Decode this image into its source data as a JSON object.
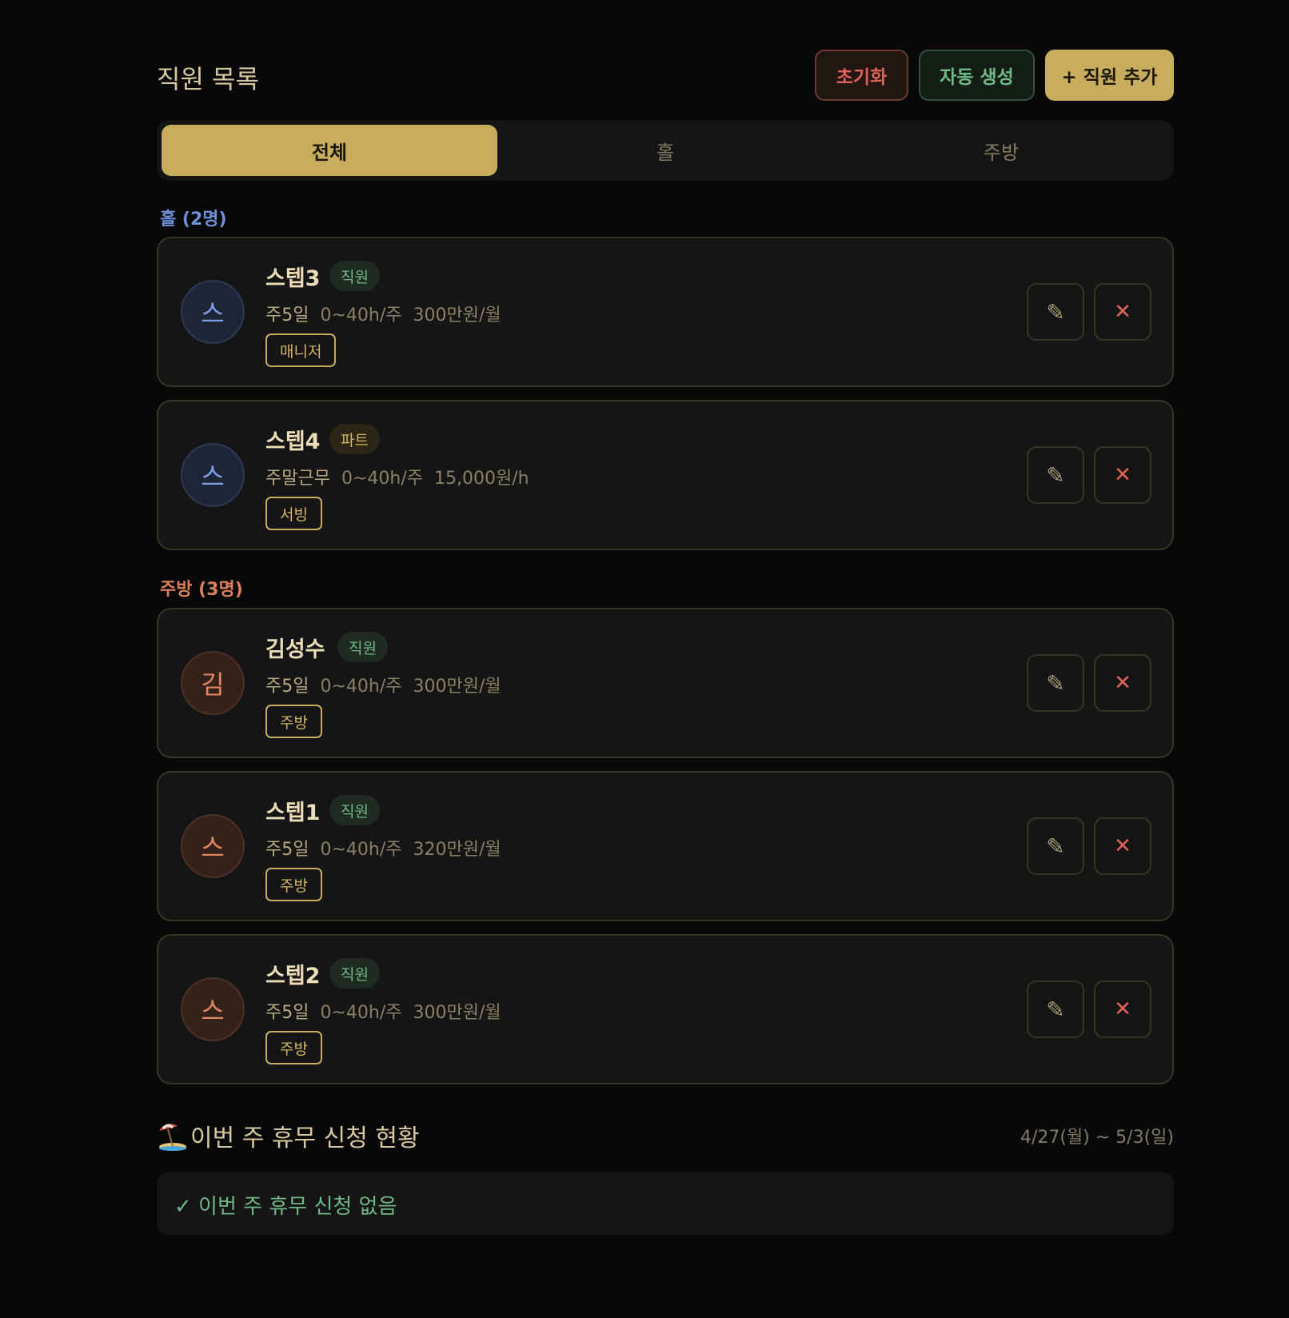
{
  "header": {
    "title": "직원 목록",
    "reset_label": "초기화",
    "auto_label": "자동 생성",
    "add_label": "+ 직원 추가"
  },
  "tabs": [
    {
      "label": "전체",
      "active": true
    },
    {
      "label": "홀",
      "active": false
    },
    {
      "label": "주방",
      "active": false
    }
  ],
  "groups": {
    "hall": {
      "label": "홀 (2명)",
      "color": "#6f8fd8",
      "staff": [
        {
          "initial": "스",
          "name": "스텝3",
          "type": "직원",
          "days": "주5일",
          "hours": "0~40h/주",
          "pay": "300만원/월",
          "role": "매니저"
        },
        {
          "initial": "스",
          "name": "스텝4",
          "type": "파트",
          "days": "주말근무",
          "hours": "0~40h/주",
          "pay": "15,000원/h",
          "role": "서빙"
        }
      ]
    },
    "kitchen": {
      "label": "주방 (3명)",
      "color": "#d9805a",
      "staff": [
        {
          "initial": "김",
          "name": "김성수",
          "type": "직원",
          "days": "주5일",
          "hours": "0~40h/주",
          "pay": "300만원/월",
          "role": "주방"
        },
        {
          "initial": "스",
          "name": "스텝1",
          "type": "직원",
          "days": "주5일",
          "hours": "0~40h/주",
          "pay": "320만원/월",
          "role": "주방"
        },
        {
          "initial": "스",
          "name": "스텝2",
          "type": "직원",
          "days": "주5일",
          "hours": "0~40h/주",
          "pay": "300만원/월",
          "role": "주방"
        }
      ]
    }
  },
  "icons": {
    "edit": "pencil-icon",
    "delete": "close-icon",
    "leave": "beach-umbrella-icon"
  },
  "leave": {
    "title": "이번 주 휴무 신청 현황",
    "range": "4/27(월) ~ 5/3(일)",
    "empty": "✓ 이번 주 휴무 신청 없음"
  },
  "colors": {
    "accent": "#c9ad5e",
    "background": "#080808",
    "card": "#151515",
    "danger": "#e0635a",
    "success": "#6fb886"
  }
}
